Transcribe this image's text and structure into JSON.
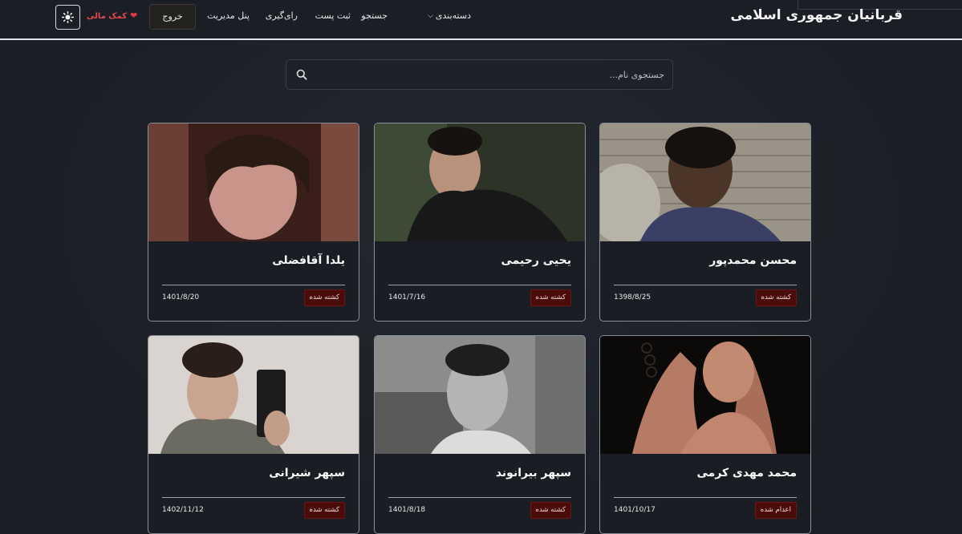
{
  "header": {
    "brand": "قربانیان جمهوری اسلامی",
    "nav": {
      "categories": "دسته‌بندی",
      "search": "جستجو",
      "submit_post": "ثبت پست",
      "voting": "رای‌گیری",
      "admin_panel": "پنل مدیریت"
    },
    "logout_label": "خروج",
    "donate_label": "کمک مالی",
    "theme_icon": "sun-icon"
  },
  "search": {
    "placeholder": "جستجوی نام..."
  },
  "cards": [
    {
      "name": "محسن محمدپور",
      "date": "1398/8/25",
      "status": "کشته شده"
    },
    {
      "name": "یحیی رحیمی",
      "date": "1401/7/16",
      "status": "کشته شده"
    },
    {
      "name": "یلدا آقافضلی",
      "date": "1401/8/20",
      "status": "کشته شده"
    },
    {
      "name": "محمد مهدی کرمی",
      "date": "1401/10/17",
      "status": "اعدام شده"
    },
    {
      "name": "سپهر بیرانوند",
      "date": "1401/8/18",
      "status": "کشته شده"
    },
    {
      "name": "سپهر شیرانی",
      "date": "1402/11/12",
      "status": "کشته شده"
    }
  ],
  "colors": {
    "background": "#1c1f26",
    "status_badge": "#4a0b0b",
    "donate": "#e24a4a"
  }
}
